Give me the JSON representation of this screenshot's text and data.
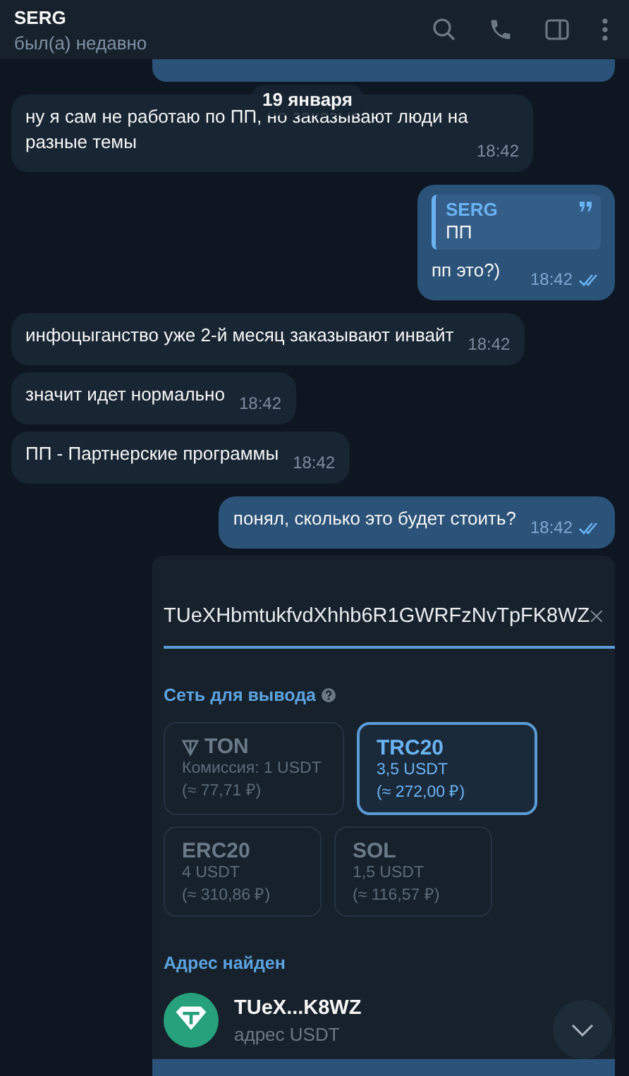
{
  "header": {
    "name": "SERG",
    "status": "был(а) недавно"
  },
  "date_badge": "19 января",
  "messages": [
    {
      "kind": "incoming",
      "text": "ну я сам не работаю по ПП, но заказывают люди на разные темы",
      "time": "18:42"
    },
    {
      "kind": "outgoing",
      "reply": {
        "author": "SERG",
        "text": "ПП"
      },
      "text": "пп это?)",
      "time": "18:42",
      "read": true
    },
    {
      "kind": "incoming",
      "text": "инфоцыганство уже 2-й месяц заказывают инвайт",
      "time": "18:42"
    },
    {
      "kind": "incoming",
      "text": "значит идет нормально",
      "time": "18:42"
    },
    {
      "kind": "incoming",
      "text": "ПП - Партнерские программы",
      "time": "18:42"
    },
    {
      "kind": "outgoing",
      "text": "понял, сколько это будет стоить?",
      "time": "18:42",
      "read": true
    }
  ],
  "photo": {
    "address_value": "TUeXHbmtukfvdXhhb6R1GWRFzNvTpFK8WZ",
    "network_heading": "Сеть для вывода",
    "networks": [
      {
        "name": "TON",
        "fee": "Комиссия: 1 USDT",
        "approx": "(≈ 77,71 ₽)",
        "selected": false,
        "kind": "ton"
      },
      {
        "name": "TRC20",
        "fee": "3,5 USDT",
        "approx": "(≈ 272,00 ₽)",
        "selected": true,
        "kind": "plain"
      },
      {
        "name": "ERC20",
        "fee": "4 USDT",
        "approx": "(≈ 310,86 ₽)",
        "selected": false,
        "kind": "plain"
      },
      {
        "name": "SOL",
        "fee": "1,5 USDT",
        "approx": "(≈ 116,57 ₽)",
        "selected": false,
        "kind": "plain"
      }
    ],
    "found_heading": "Адрес найден",
    "found_address": "TUeX...K8WZ",
    "found_label": "адрес USDT"
  }
}
